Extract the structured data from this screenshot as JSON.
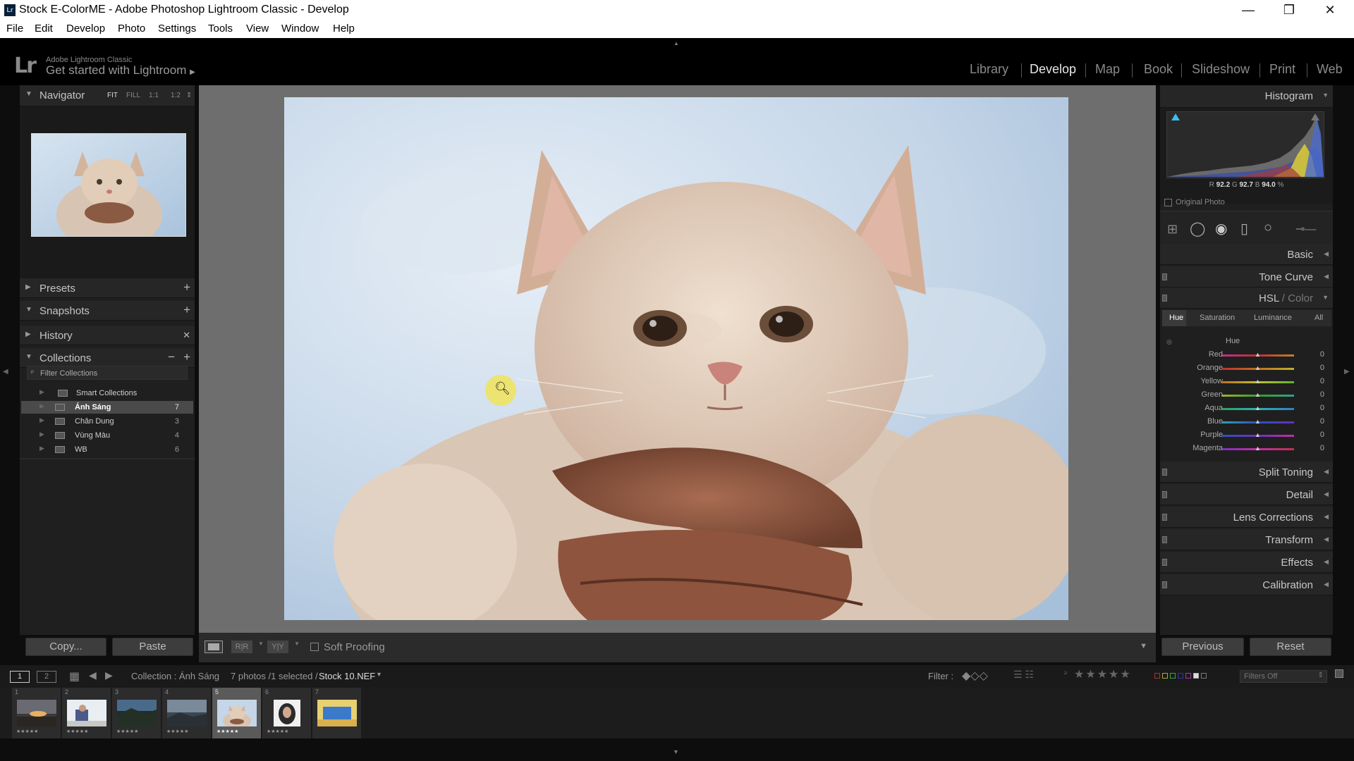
{
  "window": {
    "title": "Stock E-ColorME - Adobe Photoshop Lightroom Classic - Develop",
    "logo": "Lr"
  },
  "menu": [
    "File",
    "Edit",
    "Develop",
    "Photo",
    "Settings",
    "Tools",
    "View",
    "Window",
    "Help"
  ],
  "identity": {
    "logo": "Lr",
    "small": "Adobe Lightroom Classic",
    "big": "Get started with Lightroom",
    "arrow": "▶"
  },
  "modules": [
    "Library",
    "Develop",
    "Map",
    "Book",
    "Slideshow",
    "Print",
    "Web"
  ],
  "active_module": "Develop",
  "left": {
    "navigator": {
      "label": "Navigator",
      "options": [
        "FIT",
        "FILL",
        "1:1",
        "1:2"
      ]
    },
    "presets": "Presets",
    "snapshots": "Snapshots",
    "history": "History",
    "collections": "Collections",
    "filter_placeholder": "Filter Collections",
    "smart_collections": "Smart Collections",
    "collection_items": [
      {
        "name": "Ánh Sáng",
        "count": "7"
      },
      {
        "name": "Chân Dung",
        "count": "3"
      },
      {
        "name": "Vùng Màu",
        "count": "4"
      },
      {
        "name": "WB",
        "count": "6"
      }
    ],
    "copy": "Copy...",
    "paste": "Paste"
  },
  "toolbar": {
    "soft_proofing": "Soft Proofing",
    "before_after": "R|R",
    "yy": "Y|Y"
  },
  "right": {
    "histogram": {
      "label": "Histogram",
      "r_label": "R",
      "r": "92.2",
      "g_label": "G",
      "g": "92.7",
      "b_label": "B",
      "b": "94.0",
      "pct": "%",
      "original": "Original Photo"
    },
    "basic": "Basic",
    "tone_curve": "Tone Curve",
    "hsl": {
      "label": "HSL",
      "sep": " / ",
      "color": "Color",
      "tabs": [
        "Hue",
        "Saturation",
        "Luminance",
        "All"
      ],
      "section": "Hue",
      "sliders": [
        {
          "name": "Red",
          "value": "0"
        },
        {
          "name": "Orange",
          "value": "0"
        },
        {
          "name": "Yellow",
          "value": "0"
        },
        {
          "name": "Green",
          "value": "0"
        },
        {
          "name": "Aqua",
          "value": "0"
        },
        {
          "name": "Blue",
          "value": "0"
        },
        {
          "name": "Purple",
          "value": "0"
        },
        {
          "name": "Magenta",
          "value": "0"
        }
      ]
    },
    "panels": [
      "Split Toning",
      "Detail",
      "Lens Corrections",
      "Transform",
      "Effects",
      "Calibration"
    ],
    "previous": "Previous",
    "reset": "Reset"
  },
  "filmbar": {
    "page1": "1",
    "page2": "2",
    "collection": "Collection : Ánh Sáng",
    "count": "7 photos /1 selected /",
    "file": "Stock 10.NEF",
    "filter_label": "Filter :",
    "filters_off": "Filters Off"
  },
  "filmstrip": [
    {
      "num": "1",
      "stars": "★★★★★"
    },
    {
      "num": "2",
      "stars": "★★★★★"
    },
    {
      "num": "3",
      "stars": "★★★★★"
    },
    {
      "num": "4",
      "stars": "★★★★★"
    },
    {
      "num": "5",
      "stars": "★★★★★"
    },
    {
      "num": "6",
      "stars": "★★★★★"
    },
    {
      "num": "7",
      "stars": ""
    }
  ],
  "colors": {
    "background": "#0d0d0d",
    "panel": "#1f1f1f",
    "center": "#6e6e6e",
    "selected_cell": "#5a5a5a"
  },
  "icons": [
    "zoom-icon",
    "search-icon",
    "crop-icon",
    "spot-removal-icon",
    "red-eye-icon",
    "graduated-filter-icon",
    "radial-filter-icon",
    "brush-icon"
  ]
}
